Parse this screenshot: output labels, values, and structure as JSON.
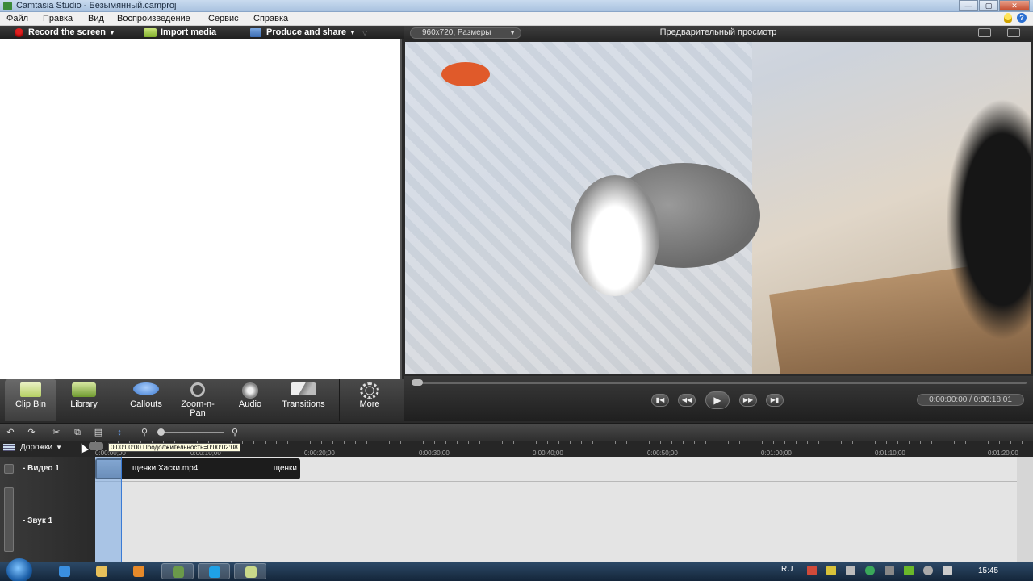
{
  "window": {
    "title": "Camtasia Studio - Безымянный.camproj"
  },
  "menu": [
    "Файл",
    "Правка",
    "Вид",
    "Воспроизведение",
    "Сервис",
    "Справка"
  ],
  "toolbar": {
    "record": "Record the screen",
    "import": "Import media",
    "produce": "Produce and share"
  },
  "tasks": [
    "Clip Bin",
    "Library",
    "Callouts",
    "Zoom-n-\nPan",
    "Audio",
    "Transitions",
    "More"
  ],
  "preview": {
    "size_label": "960x720, Размеры",
    "title": "Предварительный просмотр",
    "time": "0:00:00:00 / 0:00:18:01"
  },
  "timeline": {
    "tracks_button": "Дорожки",
    "tooltip": "0:00:00:00 Продолжительность=0:00:02:08",
    "ruler_labels": [
      "0:00:00;00",
      "0:00:10;00",
      "0:00:20;00",
      "0:00:30;00",
      "0:00:40;00",
      "0:00:50;00",
      "0:01:00;00",
      "0:01:10;00",
      "0:01:20;00"
    ],
    "tracks": [
      "Видео 1",
      "Звук 1"
    ],
    "clip_name": "щенки Хаски.mp4",
    "clip_name_2": "щенки"
  },
  "taskbar": {
    "lang": "RU",
    "clock": "15:45"
  },
  "colors": {
    "accent": "#3a7bd5",
    "record": "#e02020",
    "panel_dark": "#2a2a2a"
  }
}
